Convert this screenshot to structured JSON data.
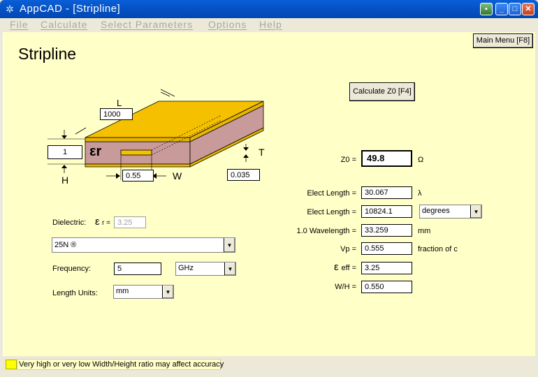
{
  "window": {
    "app_icon": "atom-icon",
    "title": "AppCAD - [Stripline]"
  },
  "menu": [
    "File",
    "Calculate",
    "Select Parameters",
    "Options",
    "Help"
  ],
  "page_title": "Stripline",
  "main_menu_button": "Main Menu [F8]",
  "calculate_button": "Calculate Z0  [F4]",
  "diagram": {
    "L_label": "L",
    "L_value": "1000",
    "H_label": "H",
    "H_value": "1",
    "er_label": "εr",
    "W_label": "W",
    "W_value": "0.55",
    "T_label": "T",
    "T_value": "0.035"
  },
  "dielectric": {
    "label": "Dielectric:",
    "er_symbol": "ε",
    "er_suffix": "r =",
    "er_value": "3.25",
    "material": "25N  ®"
  },
  "frequency": {
    "label": "Frequency:",
    "value": "5",
    "unit": "GHz"
  },
  "length_units": {
    "label": "Length Units:",
    "value": "mm"
  },
  "results": {
    "z0_label": "Z0 =",
    "z0_value": "49.8",
    "z0_unit": "Ω",
    "elect_length_1_label": "Elect Length =",
    "elect_length_1_value": "30.067",
    "elect_length_1_unit": "λ",
    "elect_length_2_label": "Elect Length =",
    "elect_length_2_value": "10824.1",
    "elect_length_2_unit": "degrees",
    "wavelength_label": "1.0 Wavelength =",
    "wavelength_value": "33.259",
    "wavelength_unit": "mm",
    "vp_label": "Vp =",
    "vp_value": "0.555",
    "vp_unit": "fraction of c",
    "eeff_symbol": "ε",
    "eeff_label": "eff =",
    "eeff_value": "3.25",
    "wh_label": "W/H =",
    "wh_value": "0.550"
  },
  "status": {
    "indicator_color": "#ffff00",
    "message": "Very high or very low Width/Height ratio may affect accuracy"
  },
  "colors": {
    "client_bg": "#ffffc8",
    "substrate_top": "#f4c000",
    "substrate_side": "#c89a9a",
    "titlebar": "#0654c7"
  }
}
